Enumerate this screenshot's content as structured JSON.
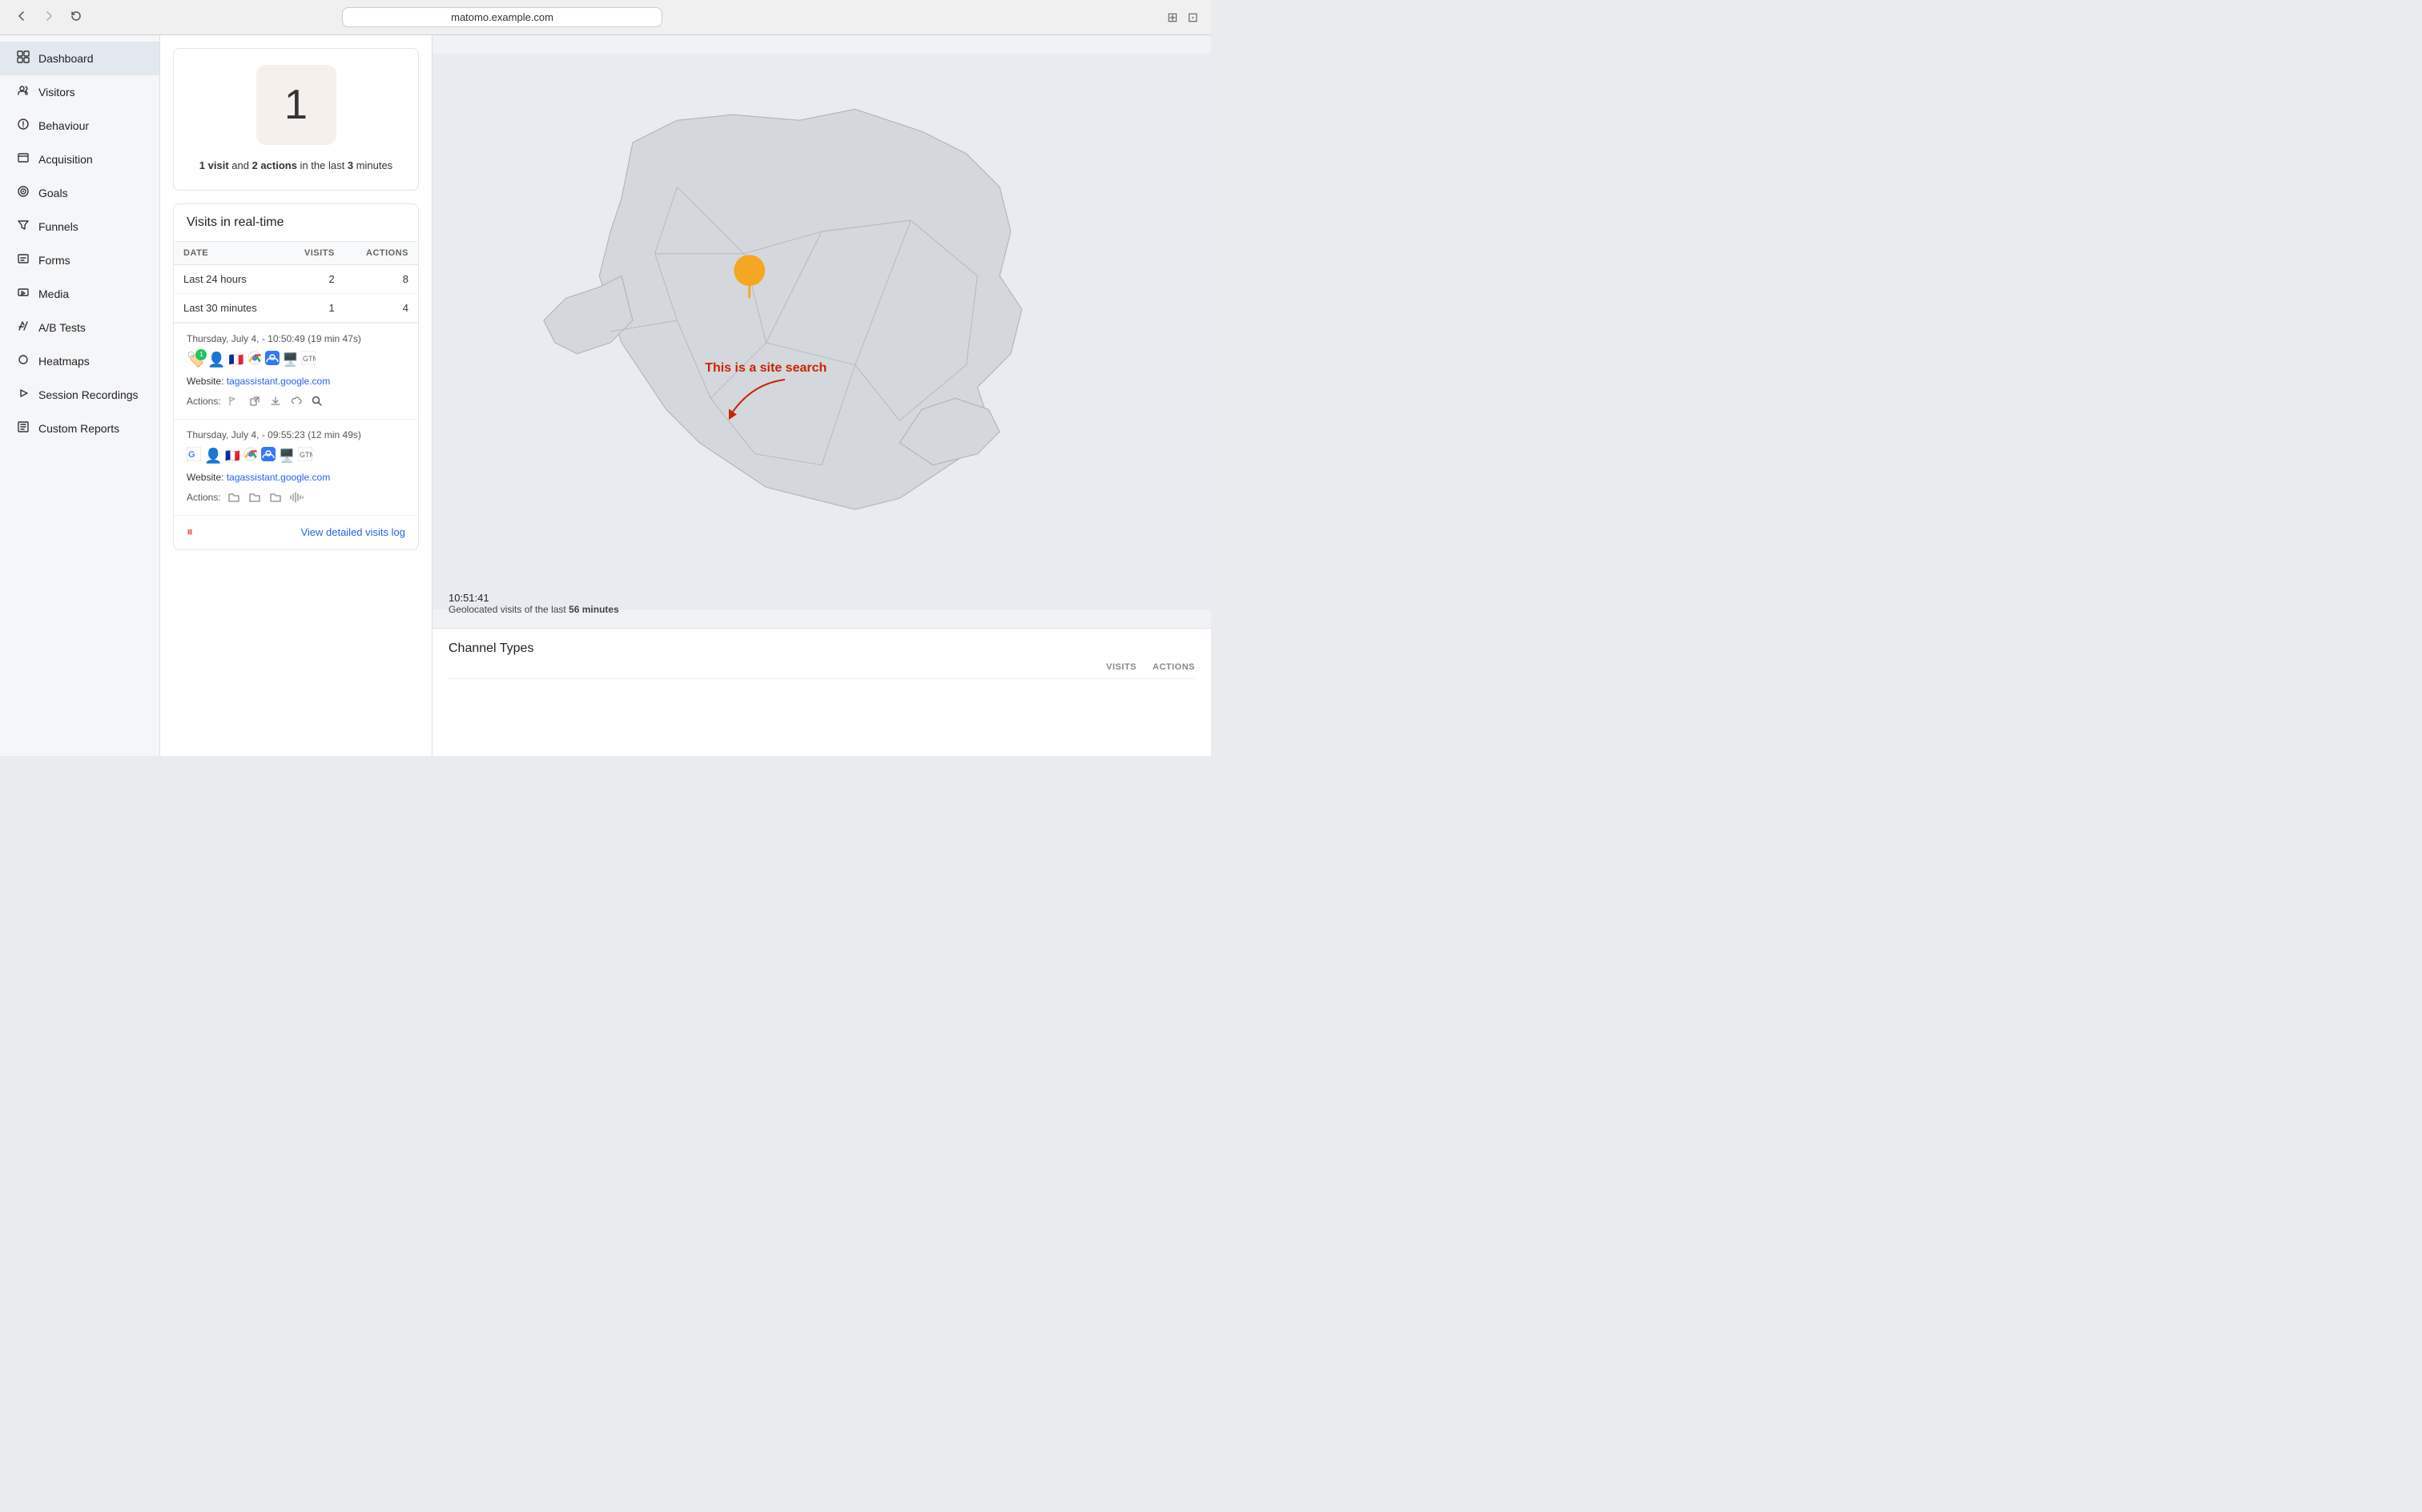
{
  "browser": {
    "back_label": "←",
    "forward_label": "→",
    "reload_label": "↺",
    "address": "matomo.example.com",
    "grid_icon": "⊞",
    "split_icon": "⊡"
  },
  "sidebar": {
    "active_item": "Dashboard",
    "items": [
      {
        "id": "dashboard",
        "label": "Dashboard",
        "icon": "⊟"
      },
      {
        "id": "visitors",
        "label": "Visitors",
        "icon": "∞"
      },
      {
        "id": "behaviour",
        "label": "Behaviour",
        "icon": "🔔"
      },
      {
        "id": "acquisition",
        "label": "Acquisition",
        "icon": "◫"
      },
      {
        "id": "goals",
        "label": "Goals",
        "icon": "◎"
      },
      {
        "id": "funnels",
        "label": "Funnels",
        "icon": "⋁"
      },
      {
        "id": "forms",
        "label": "Forms",
        "icon": "▭"
      },
      {
        "id": "media",
        "label": "Media",
        "icon": "▦"
      },
      {
        "id": "ab-tests",
        "label": "A/B Tests",
        "icon": "⚗"
      },
      {
        "id": "heatmaps",
        "label": "Heatmaps",
        "icon": "◯"
      },
      {
        "id": "session-recordings",
        "label": "Session Recordings",
        "icon": "▷"
      },
      {
        "id": "custom-reports",
        "label": "Custom Reports",
        "icon": "▣"
      }
    ]
  },
  "stats_card": {
    "big_number": "1",
    "description_part1": "1 visit",
    "description_and": " and ",
    "description_bold2": "2 actions",
    "description_part2": " in the last ",
    "description_bold3": "3",
    "description_part3": " minutes"
  },
  "realtime": {
    "title": "Visits in real-time",
    "columns": {
      "date": "DATE",
      "visits": "VISITS",
      "actions": "ACTIONS"
    },
    "rows": [
      {
        "label": "Last 24 hours",
        "visits": "2",
        "actions": "8"
      },
      {
        "label": "Last 30 minutes",
        "visits": "1",
        "actions": "4"
      }
    ],
    "visit1": {
      "time": "Thursday, July 4, - 10:50:49 (19 min 47s)",
      "website_label": "Website: ",
      "website_url": "tagassistant.google.com",
      "actions_label": "Actions:"
    },
    "visit2": {
      "time": "Thursday, July 4, - 09:55:23 (12 min 49s)",
      "website_label": "Website: ",
      "website_url": "tagassistant.google.com",
      "actions_label": "Actions:"
    },
    "footer": {
      "view_log": "View detailed visits log"
    }
  },
  "map": {
    "timestamp": "10:51:41",
    "geo_label": "Geolocated visits of the last ",
    "geo_minutes": "56 minutes"
  },
  "annotation": {
    "text": "This is a site search"
  },
  "channel_types": {
    "title": "Channel Types"
  }
}
